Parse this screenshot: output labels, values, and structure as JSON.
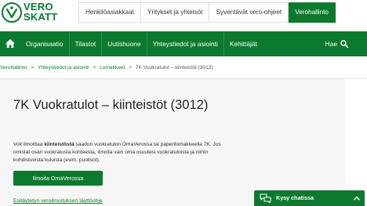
{
  "brand": {
    "line1": "VERO",
    "line2": "SKATT",
    "color": "#0c7a2e"
  },
  "top_tabs": [
    {
      "label": "Henkilöasiakkaat",
      "active": false
    },
    {
      "label": "Yritykset ja yhteisöt",
      "active": false
    },
    {
      "label": "Syventävät vero-ohjeet",
      "active": false
    },
    {
      "label": "Verohallinto",
      "active": true
    }
  ],
  "main_nav": {
    "home_icon": "home-icon",
    "items": [
      "Organisaatio",
      "Tilastot",
      "Uutishuone",
      "Yhteystiedot ja asiointi",
      "Kehittäjät"
    ],
    "search_label": "Hae",
    "search_icon": "search-icon"
  },
  "breadcrumb": [
    "Verohallinto",
    "Yhteystiedot ja asiointi",
    "Lomakkeet",
    "7K Vuokratulot – kiinteistöt (3012)"
  ],
  "main": {
    "title": "7K Vuokratulot – kiinteistöt (3012)",
    "intro_pre": "Voit ilmoittaa ",
    "intro_bold": "kiinteistöstä",
    "intro_post": " saadun vuokratulon OmaVerossa tai paperilomakkeella 7K. Jos omistat osan vuokratusta kohteesta, ilmoita vain oma osuutesi vuokratuloista ja niihin kohdistuvista kuluista (esim. puolisot).",
    "button_label": "Ilmoita OmaVerossa",
    "guide_link": "Esitäytetyn veroilmoituksen täyttöohje"
  },
  "chat": {
    "label": "Kysy chatissa",
    "icon": "chat-bubbles-icon",
    "chevron": "chevron-up-icon"
  }
}
